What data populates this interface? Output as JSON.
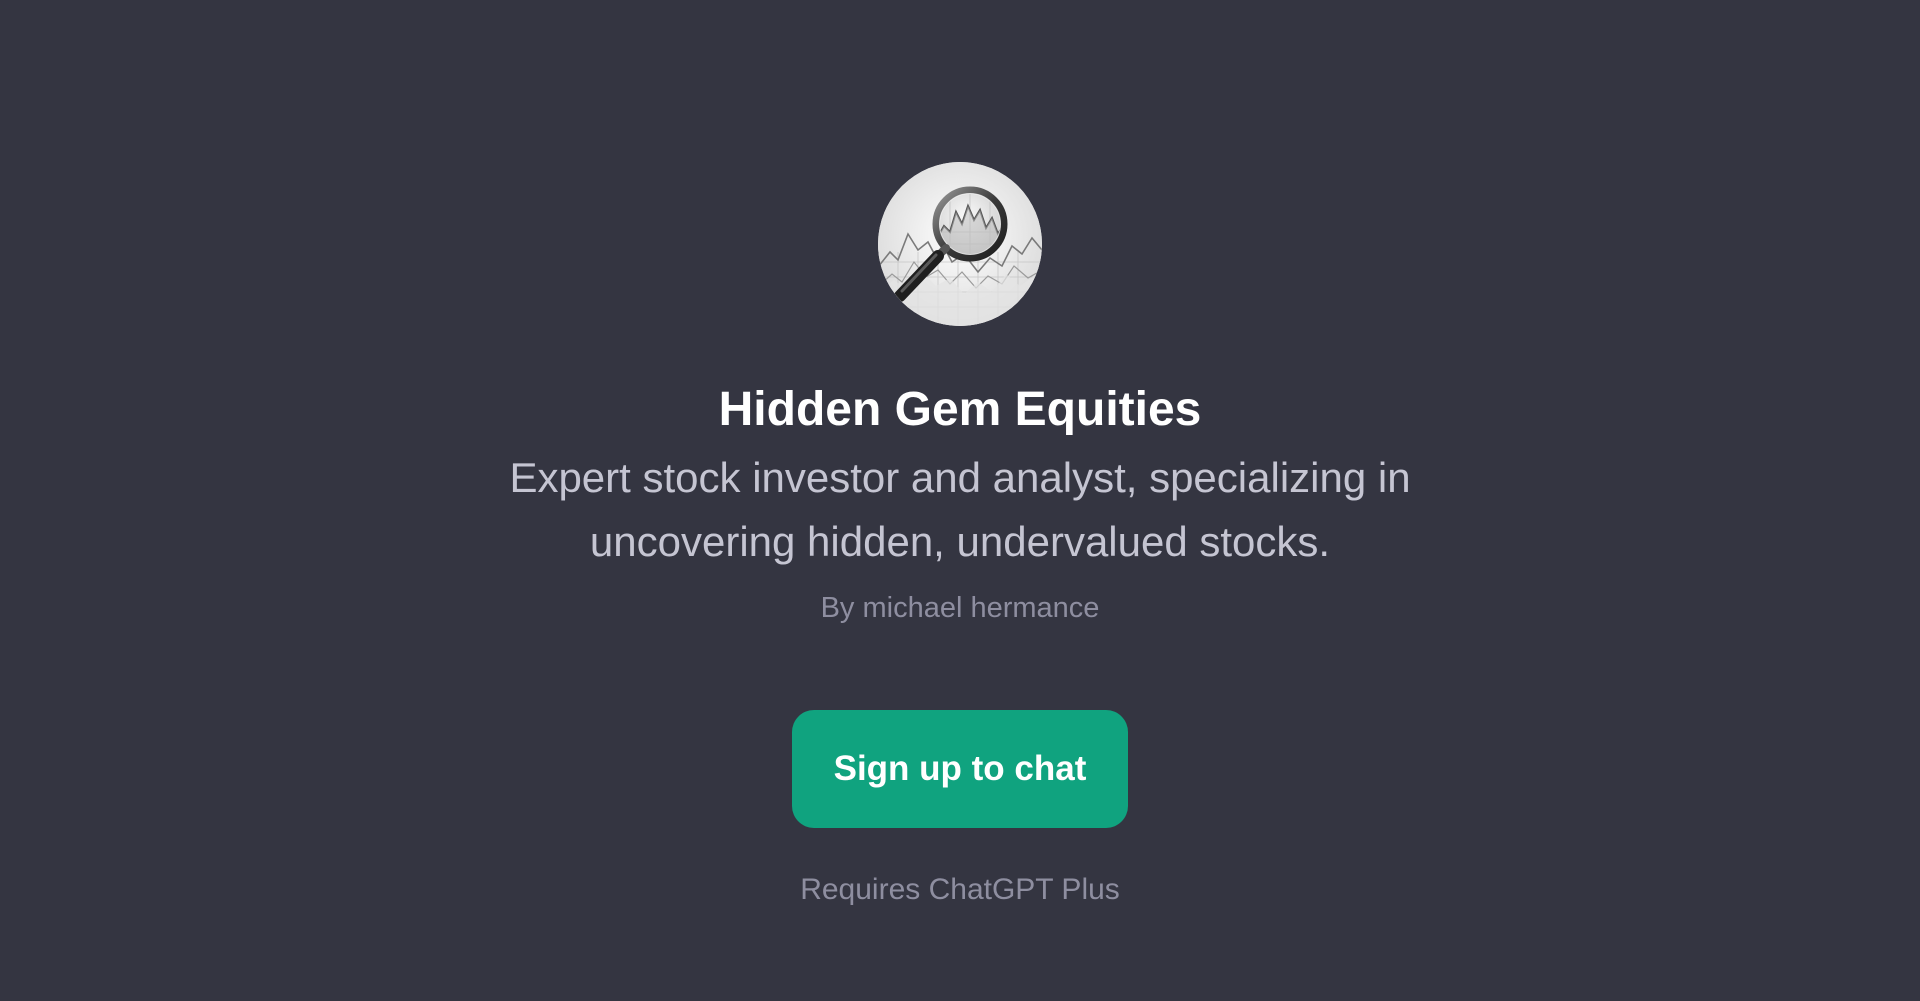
{
  "gpt": {
    "avatar_icon": "magnifying-glass-over-stock-chart",
    "name": "Hidden Gem Equities",
    "description": "Expert stock investor and analyst, specializing in uncovering hidden, undervalued stocks.",
    "author": "By michael hermance"
  },
  "cta": {
    "label": "Sign up to chat",
    "color": "#10a37f"
  },
  "footer": {
    "requirement": "Requires ChatGPT Plus"
  },
  "theme": {
    "background": "#343541",
    "title_color": "#ffffff",
    "description_color": "#c5c5d2",
    "muted_color": "#8e8ea0"
  }
}
